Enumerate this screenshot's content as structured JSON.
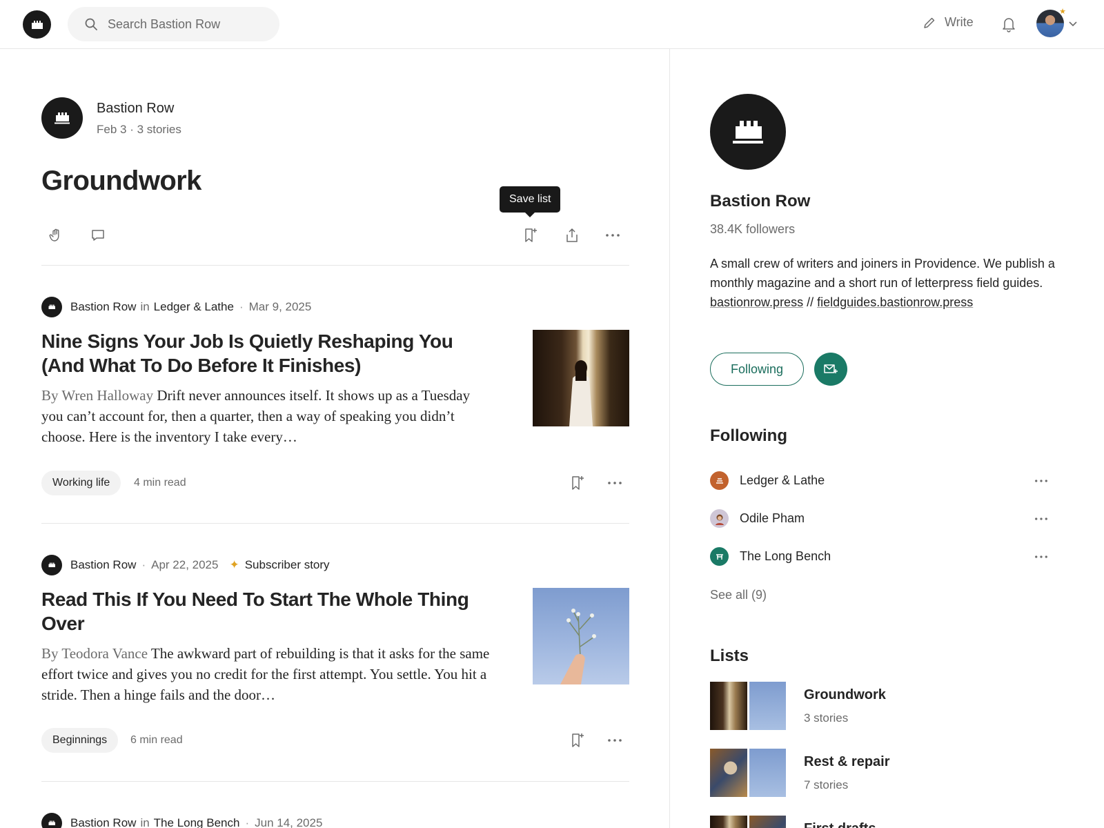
{
  "topbar": {
    "search_placeholder": "Search Bastion Row",
    "write_label": "Write"
  },
  "publication": {
    "name": "Bastion Row",
    "meta": "Feb 3 · 3 stories"
  },
  "list": {
    "title": "Groundwork",
    "tooltip": "Save list"
  },
  "stories": [
    {
      "author": "Bastion Row",
      "in_word": "in",
      "publication": "Ledger & Lathe",
      "date": "Mar 9, 2025",
      "title": "Nine Signs Your Job Is Quietly Reshaping You (And What To Do Before It Finishes)",
      "byline": "By Wren Halloway",
      "excerpt": "Drift never announces itself. It shows up as a Tuesday you can’t account for, then a quarter, then a way of speaking you didn’t choose. Here is the inventory I take every…",
      "tag": "Working life",
      "read_time": "4 min read"
    },
    {
      "author": "Bastion Row",
      "date": "Apr 22, 2025",
      "badge": "Subscriber story",
      "title": "Read This If You Need To Start The Whole Thing Over",
      "byline": "By Teodora Vance",
      "excerpt": "The awkward part of rebuilding is that it asks for the same effort twice and gives you no credit for the first attempt. You settle. You hit a stride. Then a hinge fails and the door…",
      "tag": "Beginnings",
      "read_time": "6 min read"
    },
    {
      "author": "Bastion Row",
      "in_word": "in",
      "publication": "The Long Bench",
      "date": "Jun 14, 2025"
    }
  ],
  "sidebar": {
    "name": "Bastion Row",
    "followers": "38.4K followers",
    "bio": "A small crew of writers and joiners in Providence. We publish a monthly magazine and a short run of letterpress field guides.",
    "link1": "bastionrow.press",
    "link_sep": "//",
    "link2": "fieldguides.bastionrow.press",
    "following_button": "Following",
    "following_heading": "Following",
    "following": [
      {
        "name": "Ledger & Lathe",
        "color": "#c2622d"
      },
      {
        "name": "Odile Pham",
        "color": "#cfc6d6"
      },
      {
        "name": "The Long Bench",
        "color": "#1a7a66"
      }
    ],
    "see_all": "See all (9)",
    "lists_heading": "Lists",
    "lists": [
      {
        "title": "Groundwork",
        "count": "3 stories"
      },
      {
        "title": "Rest & repair",
        "count": "7 stories"
      },
      {
        "title": "First drafts",
        "count": ""
      }
    ]
  },
  "colors": {
    "accent": "#1a7a66",
    "text": "#242424",
    "muted": "#6b6b6b",
    "star": "#e0a323"
  },
  "icons": [
    "search-icon",
    "pencil-icon",
    "bell-icon",
    "chevron-down-icon",
    "clap-icon",
    "comment-icon",
    "bookmark-plus-icon",
    "share-icon",
    "more-icon",
    "mail-plus-icon",
    "star-icon"
  ]
}
